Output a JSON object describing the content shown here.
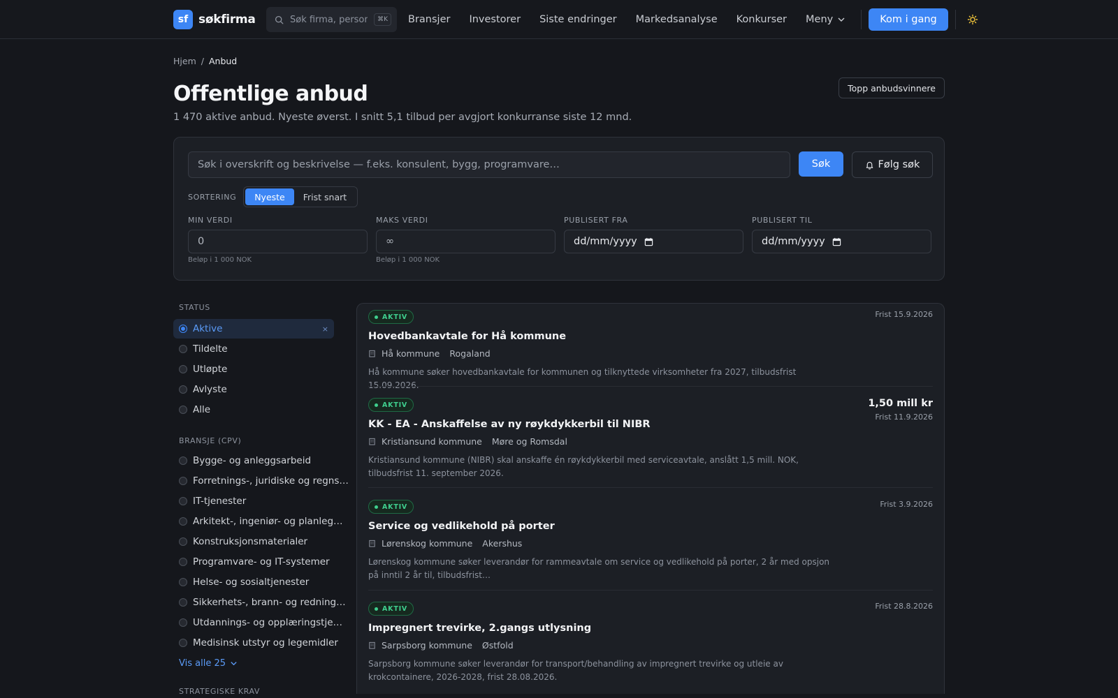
{
  "header": {
    "logo_badge": "sf",
    "logo_text": "søkfirma",
    "search_placeholder": "Søk firma, person…",
    "search_shortcut": "⌘K",
    "nav": [
      "Bransjer",
      "Investorer",
      "Siste endringer",
      "Markedsanalyse",
      "Konkurser"
    ],
    "menu_label": "Meny",
    "cta_label": "Kom i gang",
    "theme_icon": "sun-icon"
  },
  "breadcrumb": {
    "home": "Hjem",
    "sep": "/",
    "current": "Anbud"
  },
  "page": {
    "title": "Offentlige anbud",
    "subtitle": "1 470 aktive anbud. Nyeste øverst. I snitt 5,1 tilbud per avgjort konkurranse siste 12 mnd.",
    "top_winners_label": "Topp anbudsvinnere"
  },
  "filters": {
    "search_placeholder": "Søk i overskrift og beskrivelse — f.eks. konsulent, bygg, programvare…",
    "search_button": "Søk",
    "follow_button": "Følg søk",
    "sort_label": "SORTERING",
    "sort_options": [
      "Nyeste",
      "Frist snart"
    ],
    "sort_selected": "Nyeste",
    "min_label": "MIN VERDI",
    "min_placeholder": "0",
    "min_hint": "Beløp i 1 000 NOK",
    "max_label": "MAKS VERDI",
    "max_placeholder": "∞",
    "max_hint": "Beløp i 1 000 NOK",
    "from_label": "PUBLISERT FRA",
    "from_placeholder": "dd/mm/yyyy",
    "to_label": "PUBLISERT TIL",
    "to_placeholder": "dd/mm/yyyy"
  },
  "sidebar": {
    "status_heading": "STATUS",
    "status_items": [
      "Aktive",
      "Tildelte",
      "Utløpte",
      "Avlyste",
      "Alle"
    ],
    "status_selected": "Aktive",
    "clear_icon": "×",
    "cpv_heading": "BRANSJE (CPV)",
    "cpv_items": [
      "Bygge- og anleggsarbeid",
      "Forretnings-, juridiske og regns…",
      "IT-tjenester",
      "Arkitekt-, ingeniør- og planleg…",
      "Konstruksjonsmaterialer",
      "Programvare- og IT-systemer",
      "Helse- og sosialtjenester",
      "Sikkerhets-, brann- og redning…",
      "Utdannings- og opplæringstje…",
      "Medisinsk utstyr og legemidler"
    ],
    "show_all": "Vis alle 25",
    "next_heading": "STRATEGISKE KRAV"
  },
  "tenders": [
    {
      "status": "AKTIV",
      "title": "Hovedbankavtale for Hå kommune",
      "buyer": "Hå kommune",
      "region": "Rogaland",
      "description": "Hå kommune søker hovedbankavtale for kommunen og tilknyttede virksomheter fra 2027, tilbudsfrist 15.09.2026.",
      "value": "",
      "deadline": "Frist 15.9.2026"
    },
    {
      "status": "AKTIV",
      "title": "KK - EA - Anskaffelse av ny røykdykkerbil til NIBR",
      "buyer": "Kristiansund kommune",
      "region": "Møre og Romsdal",
      "description": "Kristiansund kommune (NIBR) skal anskaffe én røykdykkerbil med serviceavtale, anslått 1,5 mill. NOK, tilbudsfrist 11. september 2026.",
      "value": "1,50 mill kr",
      "deadline": "Frist 11.9.2026"
    },
    {
      "status": "AKTIV",
      "title": "Service og vedlikehold på porter",
      "buyer": "Lørenskog kommune",
      "region": "Akershus",
      "description": "Lørenskog kommune søker leverandør for rammeavtale om service og vedlikehold på porter, 2 år med opsjon på inntil 2 år til, tilbudsfrist…",
      "value": "",
      "deadline": "Frist 3.9.2026"
    },
    {
      "status": "AKTIV",
      "title": "Impregnert trevirke, 2.gangs utlysning",
      "buyer": "Sarpsborg kommune",
      "region": "Østfold",
      "description": "Sarpsborg kommune søker leverandør for transport/behandling av impregnert trevirke og utleie av krokcontainere, 2026-2028, frist 28.08.2026.",
      "value": "",
      "deadline": "Frist 28.8.2026"
    }
  ]
}
